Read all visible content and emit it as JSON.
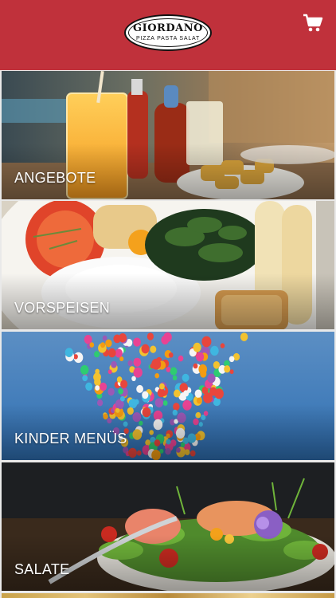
{
  "header": {
    "background": "#c0313b",
    "logo_name": "GIORDANO",
    "logo_sub": "PIZZA PASTA SALAT",
    "cart_icon": "cart-icon"
  },
  "categories": [
    {
      "label": "ANGEBOTE"
    },
    {
      "label": "VORSPEISEN"
    },
    {
      "label": "KINDER MENÜS"
    },
    {
      "label": "SALATE"
    }
  ]
}
